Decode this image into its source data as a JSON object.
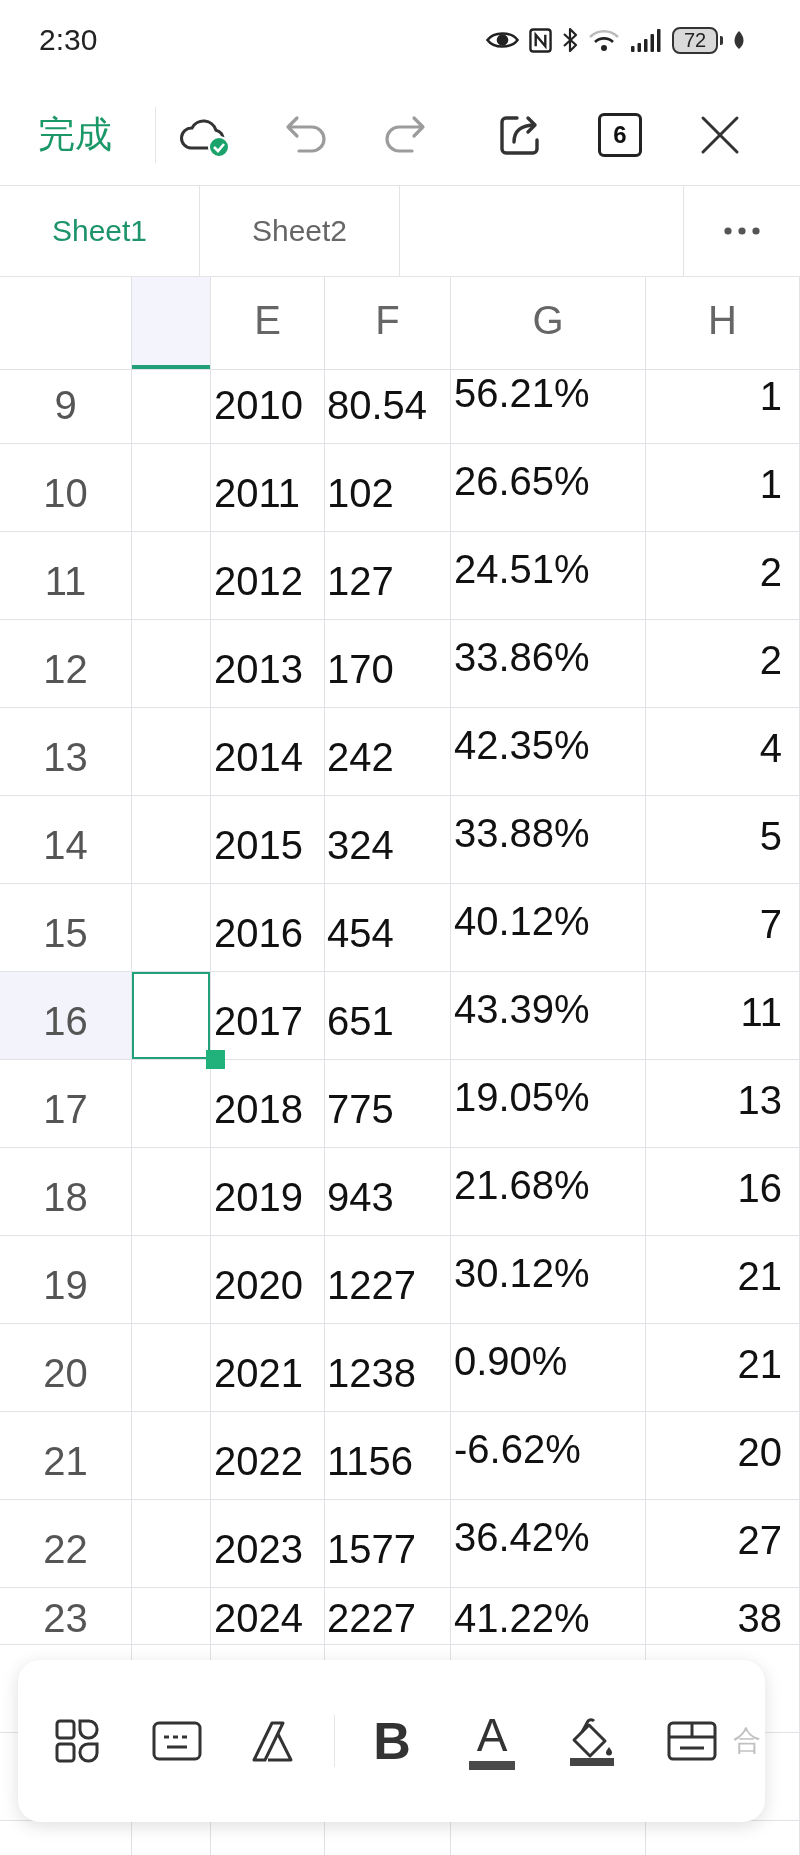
{
  "status_bar": {
    "time": "2:30",
    "battery": "72"
  },
  "toolbar": {
    "done": "完成",
    "undo": {
      "disabled": true
    },
    "redo": {
      "disabled": true
    },
    "tab_count": "6"
  },
  "sheet_tabs": [
    {
      "label": "Sheet1",
      "selected": true
    },
    {
      "label": "Sheet2",
      "selected": false
    }
  ],
  "grid": {
    "columns": [
      {
        "selected": true
      },
      {
        "label": "E",
        "selected": false
      },
      {
        "label": "F",
        "selected": false
      },
      {
        "label": "G",
        "selected": false
      },
      {
        "label": "H",
        "selected": false
      }
    ],
    "rows": [
      {
        "number": "9",
        "selected": false,
        "cells": [
          null,
          "2010",
          "80.54",
          "56.21%",
          "1"
        ]
      },
      {
        "number": "10",
        "selected": false,
        "cells": [
          null,
          "2011",
          "102",
          "26.65%",
          "1"
        ]
      },
      {
        "number": "11",
        "selected": false,
        "cells": [
          null,
          "2012",
          "127",
          "24.51%",
          "2"
        ]
      },
      {
        "number": "12",
        "selected": false,
        "cells": [
          null,
          "2013",
          "170",
          "33.86%",
          "2"
        ]
      },
      {
        "number": "13",
        "selected": false,
        "cells": [
          null,
          "2014",
          "242",
          "42.35%",
          "4"
        ]
      },
      {
        "number": "14",
        "selected": false,
        "cells": [
          null,
          "2015",
          "324",
          "33.88%",
          "5"
        ]
      },
      {
        "number": "15",
        "selected": false,
        "cells": [
          null,
          "2016",
          "454",
          "40.12%",
          "7"
        ]
      },
      {
        "number": "16",
        "selected": true,
        "cells": [
          null,
          "2017",
          "651",
          "43.39%",
          "11"
        ]
      },
      {
        "number": "17",
        "selected": false,
        "cells": [
          null,
          "2018",
          "775",
          "19.05%",
          "13"
        ]
      },
      {
        "number": "18",
        "selected": false,
        "cells": [
          null,
          "2019",
          "943",
          "21.68%",
          "16"
        ]
      },
      {
        "number": "19",
        "selected": false,
        "cells": [
          null,
          "2020",
          "1227",
          "30.12%",
          "21"
        ]
      },
      {
        "number": "20",
        "selected": false,
        "cells": [
          null,
          "2021",
          "1238",
          "0.90%",
          "21"
        ]
      },
      {
        "number": "21",
        "selected": false,
        "cells": [
          null,
          "2022",
          "1156",
          "-6.62%",
          "20"
        ]
      },
      {
        "number": "22",
        "selected": false,
        "cells": [
          null,
          "2023",
          "1577",
          "36.42%",
          "27"
        ]
      },
      {
        "number": "23",
        "selected": false,
        "cells": [
          null,
          "2024",
          "2227",
          "41.22%",
          "38"
        ]
      }
    ]
  },
  "format_bar": [
    {
      "kind": "apps"
    },
    {
      "kind": "keyboard"
    },
    {
      "kind": "style"
    },
    {
      "kind": "bold",
      "label": "B"
    },
    {
      "kind": "font_color",
      "label": "A"
    },
    {
      "kind": "fill_color"
    },
    {
      "kind": "cell_border"
    },
    {
      "kind": "label",
      "label": "合"
    }
  ]
}
